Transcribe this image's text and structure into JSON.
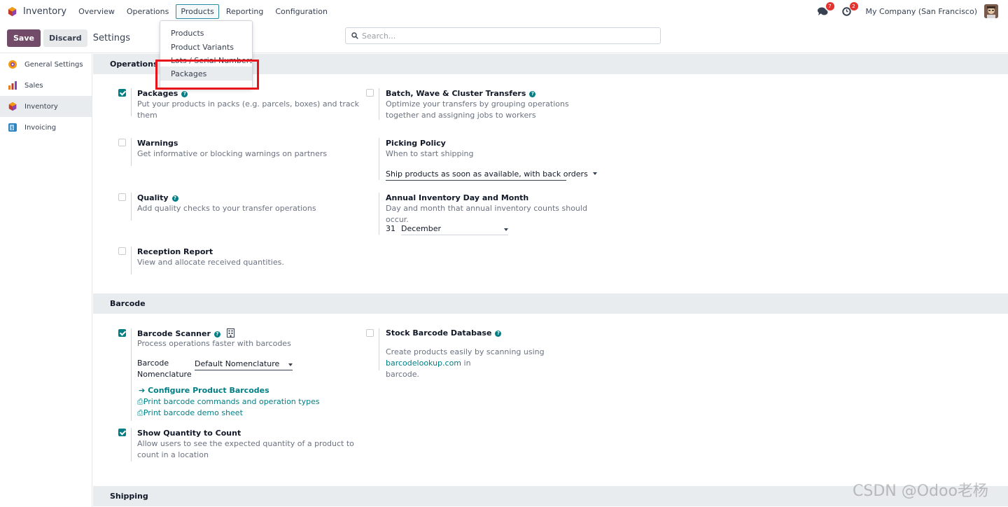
{
  "app": {
    "name": "Inventory",
    "brand_color": "#714b67",
    "accent_color": "#017e84"
  },
  "menu": {
    "items": [
      "Overview",
      "Operations",
      "Products",
      "Reporting",
      "Configuration"
    ],
    "active": "Products"
  },
  "products_menu": {
    "items": [
      "Products",
      "Product Variants",
      "Lots / Serial Numbers",
      "Packages"
    ],
    "hovered": "Packages"
  },
  "topbar": {
    "messages_badge": "7",
    "activities_badge": "2",
    "company": "My Company (San Francisco)"
  },
  "controls": {
    "save_label": "Save",
    "discard_label": "Discard",
    "title": "Settings",
    "search_placeholder": "Search..."
  },
  "sidebar": {
    "items": [
      {
        "label": "General Settings",
        "icon": "settings-app-icon"
      },
      {
        "label": "Sales",
        "icon": "sales-app-icon"
      },
      {
        "label": "Inventory",
        "icon": "inventory-app-icon",
        "active": true
      },
      {
        "label": "Invoicing",
        "icon": "invoicing-app-icon"
      }
    ]
  },
  "operations": {
    "header": "Operations",
    "packages": {
      "title": "Packages",
      "desc": "Put your products in packs (e.g. parcels, boxes) and track them",
      "checked": true
    },
    "batch": {
      "title": "Batch, Wave & Cluster Transfers",
      "desc": "Optimize your transfers by grouping operations together and assigning jobs to workers",
      "checked": false
    },
    "warnings": {
      "title": "Warnings",
      "desc": "Get informative or blocking warnings on partners",
      "checked": false
    },
    "picking": {
      "title": "Picking Policy",
      "desc": "When to start shipping",
      "value": "Ship products as soon as available, with back orders"
    },
    "quality": {
      "title": "Quality",
      "desc": "Add quality checks to your transfer operations",
      "checked": false
    },
    "annual": {
      "title": "Annual Inventory Day and Month",
      "desc": "Day and month that annual inventory counts should occur.",
      "day": "31",
      "month": "December"
    },
    "reception": {
      "title": "Reception Report",
      "desc": "View and allocate received quantities.",
      "checked": false
    }
  },
  "barcode": {
    "header": "Barcode",
    "scanner": {
      "title": "Barcode Scanner",
      "desc": "Process operations faster with barcodes",
      "checked": true,
      "nomenclature_label_1": "Barcode",
      "nomenclature_label_2": "Nomenclature",
      "nomenclature_value": "Default Nomenclature",
      "link_configure": "Configure Product Barcodes",
      "link_print_commands": "Print barcode commands and operation types",
      "link_print_demo": "Print barcode demo sheet"
    },
    "stock_db": {
      "title": "Stock Barcode Database",
      "desc_prefix": "Create products easily by scanning using ",
      "desc_link": "barcodelookup.com",
      "desc_suffix": " in",
      "desc_line2": "barcode.",
      "checked": false
    },
    "show_qty": {
      "title": "Show Quantity to Count",
      "desc": "Allow users to see the expected quantity of a product to count in a location",
      "checked": true
    }
  },
  "shipping": {
    "header": "Shipping"
  },
  "watermark": "CSDN @Odoo老杨"
}
